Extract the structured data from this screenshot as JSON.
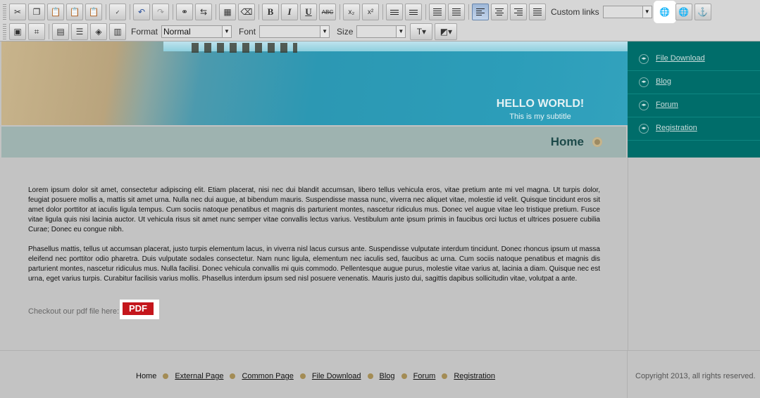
{
  "toolbar": {
    "row1": [
      "cut-icon",
      "copy-icon",
      "paste-icon",
      "paste-text-icon",
      "paste-word-icon",
      "spellcheck-icon",
      "undo-icon",
      "redo-icon",
      "find-icon",
      "replace-icon",
      "select-all-icon",
      "remove-format-icon",
      "bold",
      "italic",
      "underline",
      "strikethrough",
      "subscript-icon",
      "superscript-icon",
      "numbered-list-icon",
      "bulleted-list-icon",
      "outdent-icon",
      "indent-icon",
      "align-left-icon",
      "align-center-icon",
      "align-right-icon",
      "justify-icon"
    ],
    "bold_glyph": "B",
    "italic_glyph": "I",
    "underline_glyph": "U",
    "strike_glyph": "ABC",
    "custom_links_label": "Custom links",
    "custom_links_value": "",
    "format_label": "Format",
    "format_value": "Normal",
    "font_label": "Font",
    "font_value": "",
    "size_label": "Size",
    "size_value": ""
  },
  "banner": {
    "title": "HELLO WORLD!",
    "subtitle": "This is my subtitle"
  },
  "page_heading": "Home",
  "sidenav": {
    "items": [
      {
        "label": "File Download"
      },
      {
        "label": "Blog"
      },
      {
        "label": "Forum"
      },
      {
        "label": "Registration"
      }
    ]
  },
  "content": {
    "paragraph1": "Lorem ipsum dolor sit amet, consectetur adipiscing elit. Etiam placerat, nisi nec dui blandit accumsan, libero tellus vehicula eros, vitae pretium ante mi vel magna. Ut turpis dolor, feugiat posuere mollis a, mattis sit amet urna. Nulla nec dui augue, at bibendum mauris. Suspendisse massa nunc, viverra nec aliquet vitae, molestie id velit. Quisque tincidunt eros sit amet dolor porttitor at iaculis ligula tempus. Cum sociis natoque penatibus et magnis dis parturient montes, nascetur ridiculus mus. Donec vel augue vitae leo tristique pretium. Fusce vitae ligula quis nisi lacinia auctor. Ut vehicula risus sit amet nunc semper vitae convallis lectus varius. Vestibulum ante ipsum primis in faucibus orci luctus et ultrices posuere cubilia Curae; Donec eu congue nibh.",
    "paragraph2": "Phasellus mattis, tellus ut accumsan placerat, justo turpis elementum lacus, in viverra nisl lacus cursus ante. Suspendisse vulputate interdum tincidunt. Donec rhoncus ipsum ut massa eleifend nec porttitor odio pharetra. Duis vulputate sodales consectetur. Nam nunc ligula, elementum nec iaculis sed, faucibus ac urna. Cum sociis natoque penatibus et magnis dis parturient montes, nascetur ridiculus mus. Nulla facilisi. Donec vehicula convallis mi quis commodo. Pellentesque augue purus, molestie vitae varius at, lacinia a diam. Quisque nec est urna, eget varius turpis. Curabitur facilisis varius mollis. Phasellus interdum ipsum sed nisl posuere venenatis. Mauris justo dui, sagittis dapibus sollicitudin vitae, volutpat a ante.",
    "pdf_text": "Checkout our pdf file here:",
    "pdf_badge": "PDF"
  },
  "footer": {
    "links": [
      "Home",
      "External Page",
      "Common Page",
      "File Download",
      "Blog",
      "Forum",
      "Registration"
    ],
    "copyright": "Copyright 2013, all rights reserved."
  },
  "colors": {
    "nav_bg": "#006d6a",
    "homebar_bg": "#9eb3b0",
    "heading_color": "#1d4a4a",
    "pdf_red": "#c4161c"
  }
}
